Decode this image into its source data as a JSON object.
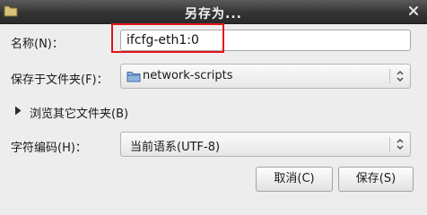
{
  "dialog": {
    "title": "另存为...",
    "icons": {
      "window": "folder-icon",
      "close": "close-icon"
    }
  },
  "form": {
    "name_label": "名称(N)：",
    "name_value": "ifcfg-eth1:0",
    "save_in_label": "保存于文件夹(F)：",
    "save_in_value": "network-scripts",
    "browse_label": "浏览其它文件夹(B)",
    "encoding_label": "字符编码(H)：",
    "encoding_value": "当前语系(UTF-8)"
  },
  "buttons": {
    "cancel": "取消(C)",
    "save": "保存(S)"
  },
  "colors": {
    "highlight": "#e3151a",
    "titlebar": "#343434"
  }
}
